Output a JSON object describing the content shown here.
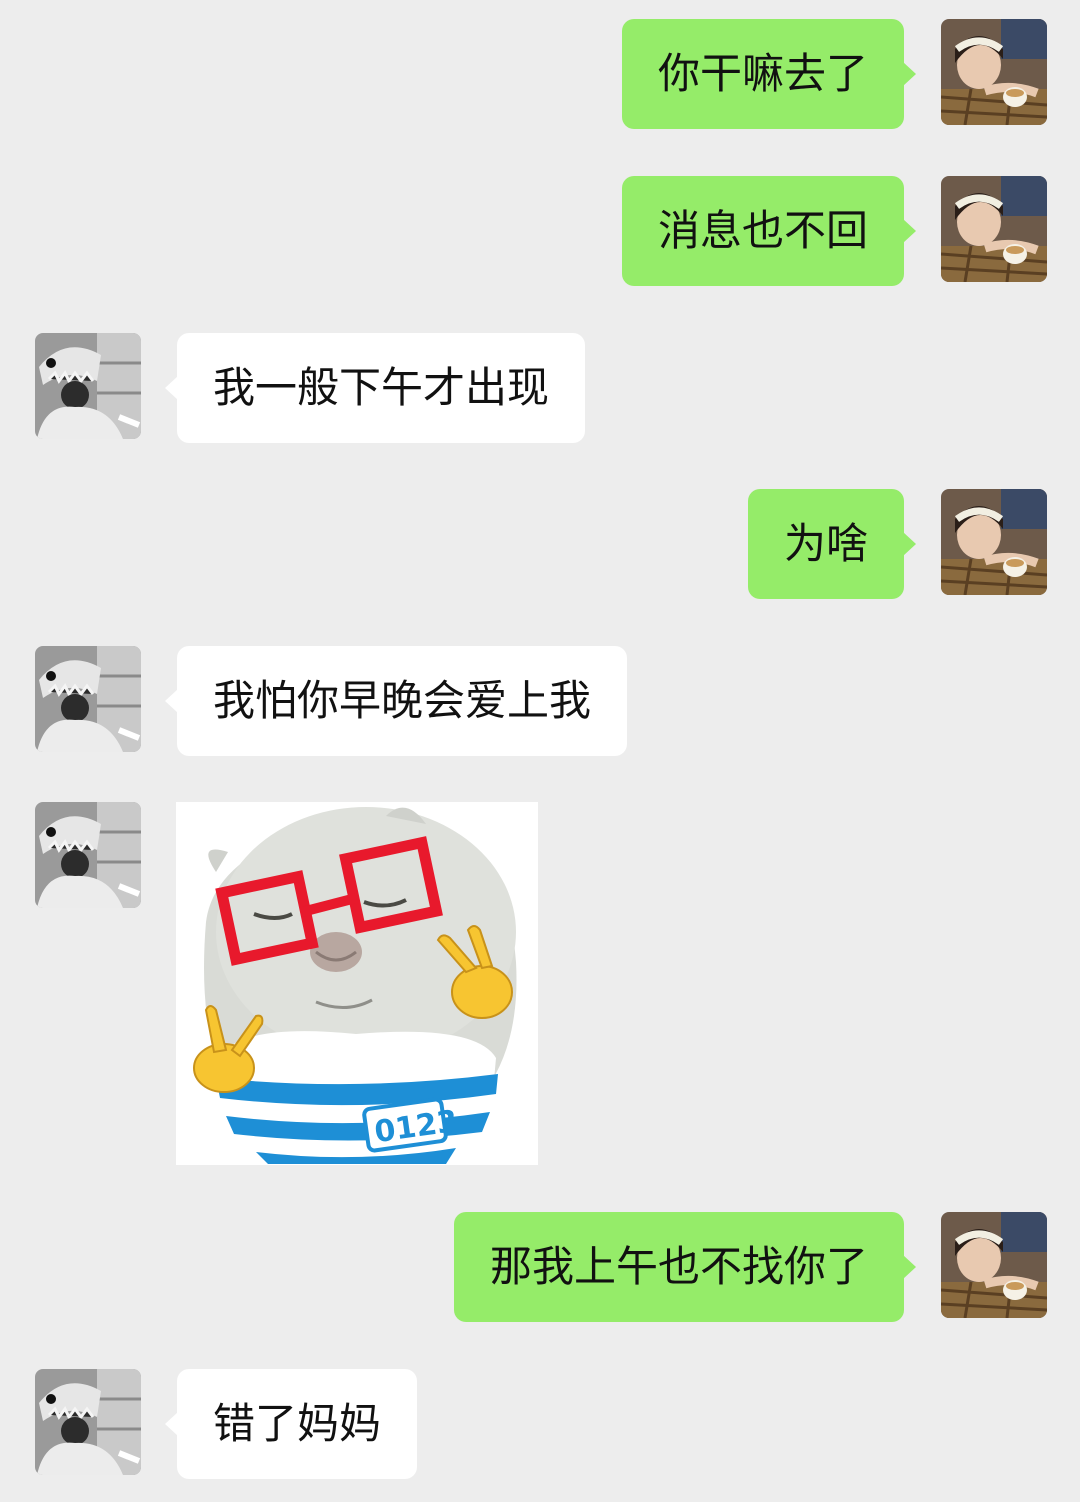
{
  "chat": {
    "messages": [
      {
        "side": "out",
        "text": "你干嘛去了"
      },
      {
        "side": "out",
        "text": "消息也不回"
      },
      {
        "side": "in",
        "text": "我一般下午才出现"
      },
      {
        "side": "out",
        "text": "为啥"
      },
      {
        "side": "in",
        "text": "我怕你早晚会爱上我"
      },
      {
        "side": "in",
        "type": "sticker",
        "sticker": "cat-with-red-glasses-peace-sign-sticker",
        "sticker_text": "0123"
      },
      {
        "side": "out",
        "text": "那我上午也不找你了"
      },
      {
        "side": "in",
        "text": "错了妈妈"
      }
    ]
  },
  "avatars": {
    "me": "avatar-girl-with-coffee-cup",
    "contact": "avatar-person-with-shark-hat"
  },
  "colors": {
    "background": "#ededed",
    "outgoing_bubble": "#95ec69",
    "incoming_bubble": "#ffffff",
    "text": "#111111",
    "glasses": "#e8192c",
    "shirt_stripe": "#1e8fd6",
    "emoji_hand": "#f7c531"
  }
}
